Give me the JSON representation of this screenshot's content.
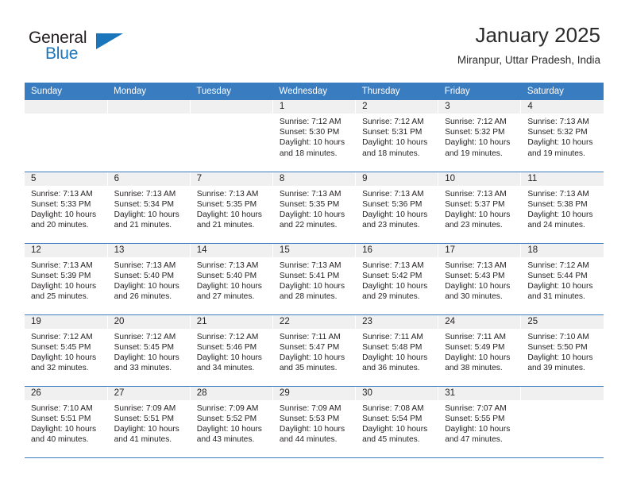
{
  "logo": {
    "word_top": "General",
    "word_bottom": "Blue",
    "accent_color": "#1b75bb",
    "triangle_icon": "triangle-icon"
  },
  "header": {
    "title": "January 2025",
    "location": "Miranpur, Uttar Pradesh, India"
  },
  "theme": {
    "header_bar_color": "#3a7cc0",
    "day_number_bg": "#f0f0f0",
    "text_color": "#231f20"
  },
  "weekday_headers": [
    "Sunday",
    "Monday",
    "Tuesday",
    "Wednesday",
    "Thursday",
    "Friday",
    "Saturday"
  ],
  "weeks": [
    [
      {
        "day": "",
        "lines": []
      },
      {
        "day": "",
        "lines": []
      },
      {
        "day": "",
        "lines": []
      },
      {
        "day": "1",
        "lines": [
          "Sunrise: 7:12 AM",
          "Sunset: 5:30 PM",
          "Daylight: 10 hours and 18 minutes."
        ]
      },
      {
        "day": "2",
        "lines": [
          "Sunrise: 7:12 AM",
          "Sunset: 5:31 PM",
          "Daylight: 10 hours and 18 minutes."
        ]
      },
      {
        "day": "3",
        "lines": [
          "Sunrise: 7:12 AM",
          "Sunset: 5:32 PM",
          "Daylight: 10 hours and 19 minutes."
        ]
      },
      {
        "day": "4",
        "lines": [
          "Sunrise: 7:13 AM",
          "Sunset: 5:32 PM",
          "Daylight: 10 hours and 19 minutes."
        ]
      }
    ],
    [
      {
        "day": "5",
        "lines": [
          "Sunrise: 7:13 AM",
          "Sunset: 5:33 PM",
          "Daylight: 10 hours and 20 minutes."
        ]
      },
      {
        "day": "6",
        "lines": [
          "Sunrise: 7:13 AM",
          "Sunset: 5:34 PM",
          "Daylight: 10 hours and 21 minutes."
        ]
      },
      {
        "day": "7",
        "lines": [
          "Sunrise: 7:13 AM",
          "Sunset: 5:35 PM",
          "Daylight: 10 hours and 21 minutes."
        ]
      },
      {
        "day": "8",
        "lines": [
          "Sunrise: 7:13 AM",
          "Sunset: 5:35 PM",
          "Daylight: 10 hours and 22 minutes."
        ]
      },
      {
        "day": "9",
        "lines": [
          "Sunrise: 7:13 AM",
          "Sunset: 5:36 PM",
          "Daylight: 10 hours and 23 minutes."
        ]
      },
      {
        "day": "10",
        "lines": [
          "Sunrise: 7:13 AM",
          "Sunset: 5:37 PM",
          "Daylight: 10 hours and 23 minutes."
        ]
      },
      {
        "day": "11",
        "lines": [
          "Sunrise: 7:13 AM",
          "Sunset: 5:38 PM",
          "Daylight: 10 hours and 24 minutes."
        ]
      }
    ],
    [
      {
        "day": "12",
        "lines": [
          "Sunrise: 7:13 AM",
          "Sunset: 5:39 PM",
          "Daylight: 10 hours and 25 minutes."
        ]
      },
      {
        "day": "13",
        "lines": [
          "Sunrise: 7:13 AM",
          "Sunset: 5:40 PM",
          "Daylight: 10 hours and 26 minutes."
        ]
      },
      {
        "day": "14",
        "lines": [
          "Sunrise: 7:13 AM",
          "Sunset: 5:40 PM",
          "Daylight: 10 hours and 27 minutes."
        ]
      },
      {
        "day": "15",
        "lines": [
          "Sunrise: 7:13 AM",
          "Sunset: 5:41 PM",
          "Daylight: 10 hours and 28 minutes."
        ]
      },
      {
        "day": "16",
        "lines": [
          "Sunrise: 7:13 AM",
          "Sunset: 5:42 PM",
          "Daylight: 10 hours and 29 minutes."
        ]
      },
      {
        "day": "17",
        "lines": [
          "Sunrise: 7:13 AM",
          "Sunset: 5:43 PM",
          "Daylight: 10 hours and 30 minutes."
        ]
      },
      {
        "day": "18",
        "lines": [
          "Sunrise: 7:12 AM",
          "Sunset: 5:44 PM",
          "Daylight: 10 hours and 31 minutes."
        ]
      }
    ],
    [
      {
        "day": "19",
        "lines": [
          "Sunrise: 7:12 AM",
          "Sunset: 5:45 PM",
          "Daylight: 10 hours and 32 minutes."
        ]
      },
      {
        "day": "20",
        "lines": [
          "Sunrise: 7:12 AM",
          "Sunset: 5:45 PM",
          "Daylight: 10 hours and 33 minutes."
        ]
      },
      {
        "day": "21",
        "lines": [
          "Sunrise: 7:12 AM",
          "Sunset: 5:46 PM",
          "Daylight: 10 hours and 34 minutes."
        ]
      },
      {
        "day": "22",
        "lines": [
          "Sunrise: 7:11 AM",
          "Sunset: 5:47 PM",
          "Daylight: 10 hours and 35 minutes."
        ]
      },
      {
        "day": "23",
        "lines": [
          "Sunrise: 7:11 AM",
          "Sunset: 5:48 PM",
          "Daylight: 10 hours and 36 minutes."
        ]
      },
      {
        "day": "24",
        "lines": [
          "Sunrise: 7:11 AM",
          "Sunset: 5:49 PM",
          "Daylight: 10 hours and 38 minutes."
        ]
      },
      {
        "day": "25",
        "lines": [
          "Sunrise: 7:10 AM",
          "Sunset: 5:50 PM",
          "Daylight: 10 hours and 39 minutes."
        ]
      }
    ],
    [
      {
        "day": "26",
        "lines": [
          "Sunrise: 7:10 AM",
          "Sunset: 5:51 PM",
          "Daylight: 10 hours and 40 minutes."
        ]
      },
      {
        "day": "27",
        "lines": [
          "Sunrise: 7:09 AM",
          "Sunset: 5:51 PM",
          "Daylight: 10 hours and 41 minutes."
        ]
      },
      {
        "day": "28",
        "lines": [
          "Sunrise: 7:09 AM",
          "Sunset: 5:52 PM",
          "Daylight: 10 hours and 43 minutes."
        ]
      },
      {
        "day": "29",
        "lines": [
          "Sunrise: 7:09 AM",
          "Sunset: 5:53 PM",
          "Daylight: 10 hours and 44 minutes."
        ]
      },
      {
        "day": "30",
        "lines": [
          "Sunrise: 7:08 AM",
          "Sunset: 5:54 PM",
          "Daylight: 10 hours and 45 minutes."
        ]
      },
      {
        "day": "31",
        "lines": [
          "Sunrise: 7:07 AM",
          "Sunset: 5:55 PM",
          "Daylight: 10 hours and 47 minutes."
        ]
      },
      {
        "day": "",
        "lines": []
      }
    ]
  ]
}
